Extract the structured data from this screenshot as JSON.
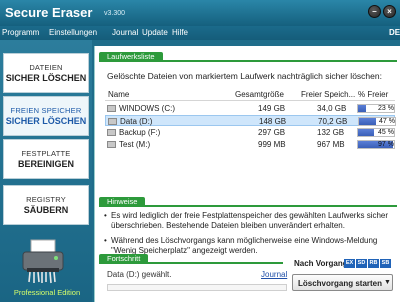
{
  "app": {
    "title": "Secure Eraser",
    "version": "v3.300",
    "edition": "Professional Edition"
  },
  "window": {
    "minimize": "–",
    "close": "×"
  },
  "menu": [
    "Programm",
    "Einstellungen",
    "Journal",
    "Update",
    "Hilfe"
  ],
  "menu_right": "DE",
  "sidebar": [
    {
      "line1": "DATEIEN",
      "line2": "SICHER LÖSCHEN",
      "active": false
    },
    {
      "line1": "FREIEN SPEICHER",
      "line2": "SICHER LÖSCHEN",
      "active": true
    },
    {
      "line1": "FESTPLATTE",
      "line2": "BEREINIGEN",
      "active": false
    },
    {
      "line1": "REGISTRY",
      "line2": "SÄUBERN",
      "active": false
    }
  ],
  "sections": {
    "drives": "Laufwerksliste",
    "hints": "Hinweise",
    "progress": "Fortschritt"
  },
  "drives_heading": "Gelöschte Dateien von markiertem Laufwerk nachträglich sicher löschen:",
  "table": {
    "headers": [
      "Name",
      "Gesamtgröße",
      "Freier Speich...",
      "% Freier"
    ],
    "rows": [
      {
        "name": "WINDOWS (C:)",
        "total": "149 GB",
        "free": "34,0 GB",
        "percent_label": "23 %",
        "percent": 23,
        "selected": false
      },
      {
        "name": "Data (D:)",
        "total": "148 GB",
        "free": "70,2 GB",
        "percent_label": "47 %",
        "percent": 47,
        "selected": true
      },
      {
        "name": "Backup (F:)",
        "total": "297 GB",
        "free": "132 GB",
        "percent_label": "45 %",
        "percent": 45,
        "selected": false
      },
      {
        "name": "Test (M:)",
        "total": "999 MB",
        "free": "967 MB",
        "percent_label": "97 %",
        "percent": 97,
        "selected": false
      }
    ]
  },
  "hints": [
    "Es wird lediglich der freie Festplattenspeicher des gewählten Laufwerks sicher überschrieben. Bestehende Dateien bleiben unverändert erhalten.",
    "Während des Löschvorgangs kann möglicherweise eine Windows-Meldung \"Wenig Speicherplatz\" angezeigt werden."
  ],
  "progress": {
    "status": "Data (D:) gewählt.",
    "journal": "Journal",
    "value": 0
  },
  "after": {
    "label": "Nach Vorgang:",
    "options": [
      "EX",
      "SD",
      "RB",
      "SB"
    ]
  },
  "start_button": "Löschvorgang starten",
  "colors": {
    "accent_green": "#2d9a3b",
    "brand_blue": "#1f6d8a",
    "option_blue": "#2063b8",
    "edition_green": "#d6ff6a"
  }
}
